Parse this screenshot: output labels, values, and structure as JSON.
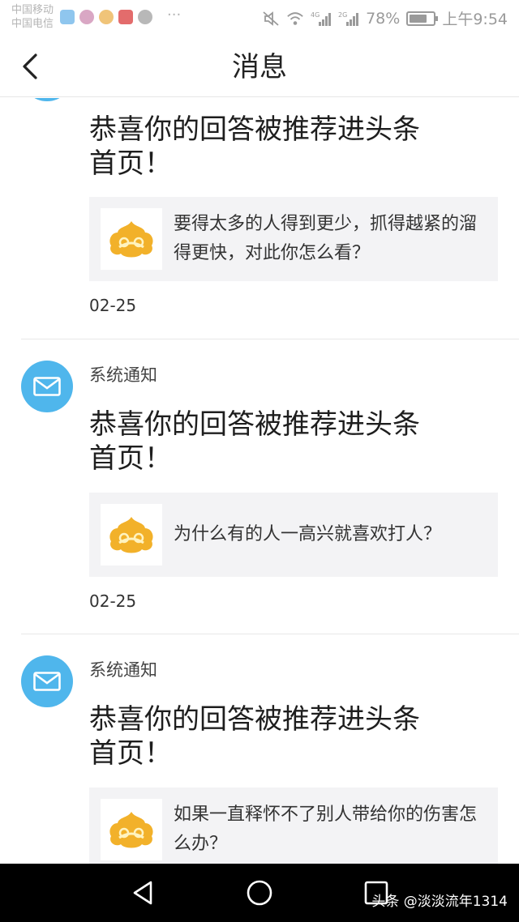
{
  "status_bar": {
    "carrier_1": "中国移动",
    "carrier_2": "中国电信",
    "net_4g": "4G",
    "net_2g": "2G",
    "battery_text": "78%",
    "battery_level": 0.78,
    "time": "上午9:54",
    "icons": [
      "mute-icon",
      "wifi-icon",
      "signal-4g-icon",
      "signal-2g-icon",
      "battery-icon"
    ]
  },
  "header": {
    "title": "消息"
  },
  "messages": [
    {
      "sender": "",
      "headline_1": "恭喜你的回答被推荐进头条",
      "headline_2": "首页！",
      "question": "要得太多的人得到更少，抓得越紧的溜得更快，对此你怎么看？",
      "date": "02-25"
    },
    {
      "sender": "系统通知",
      "headline_1": "恭喜你的回答被推荐进头条",
      "headline_2": "首页！",
      "question": "为什么有的人一高兴就喜欢打人？",
      "date": "02-25"
    },
    {
      "sender": "系统通知",
      "headline_1": "恭喜你的回答被推荐进头条",
      "headline_2": "首页！",
      "question": "如果一直释怀不了别人带给你的伤害怎么办？",
      "date": ""
    }
  ],
  "watermark": "头条 @淡淡流年1314",
  "colors": {
    "avatar": "#4fb6ec",
    "card_bg": "#f3f3f5",
    "thumb_gold": "#f2b12a"
  }
}
